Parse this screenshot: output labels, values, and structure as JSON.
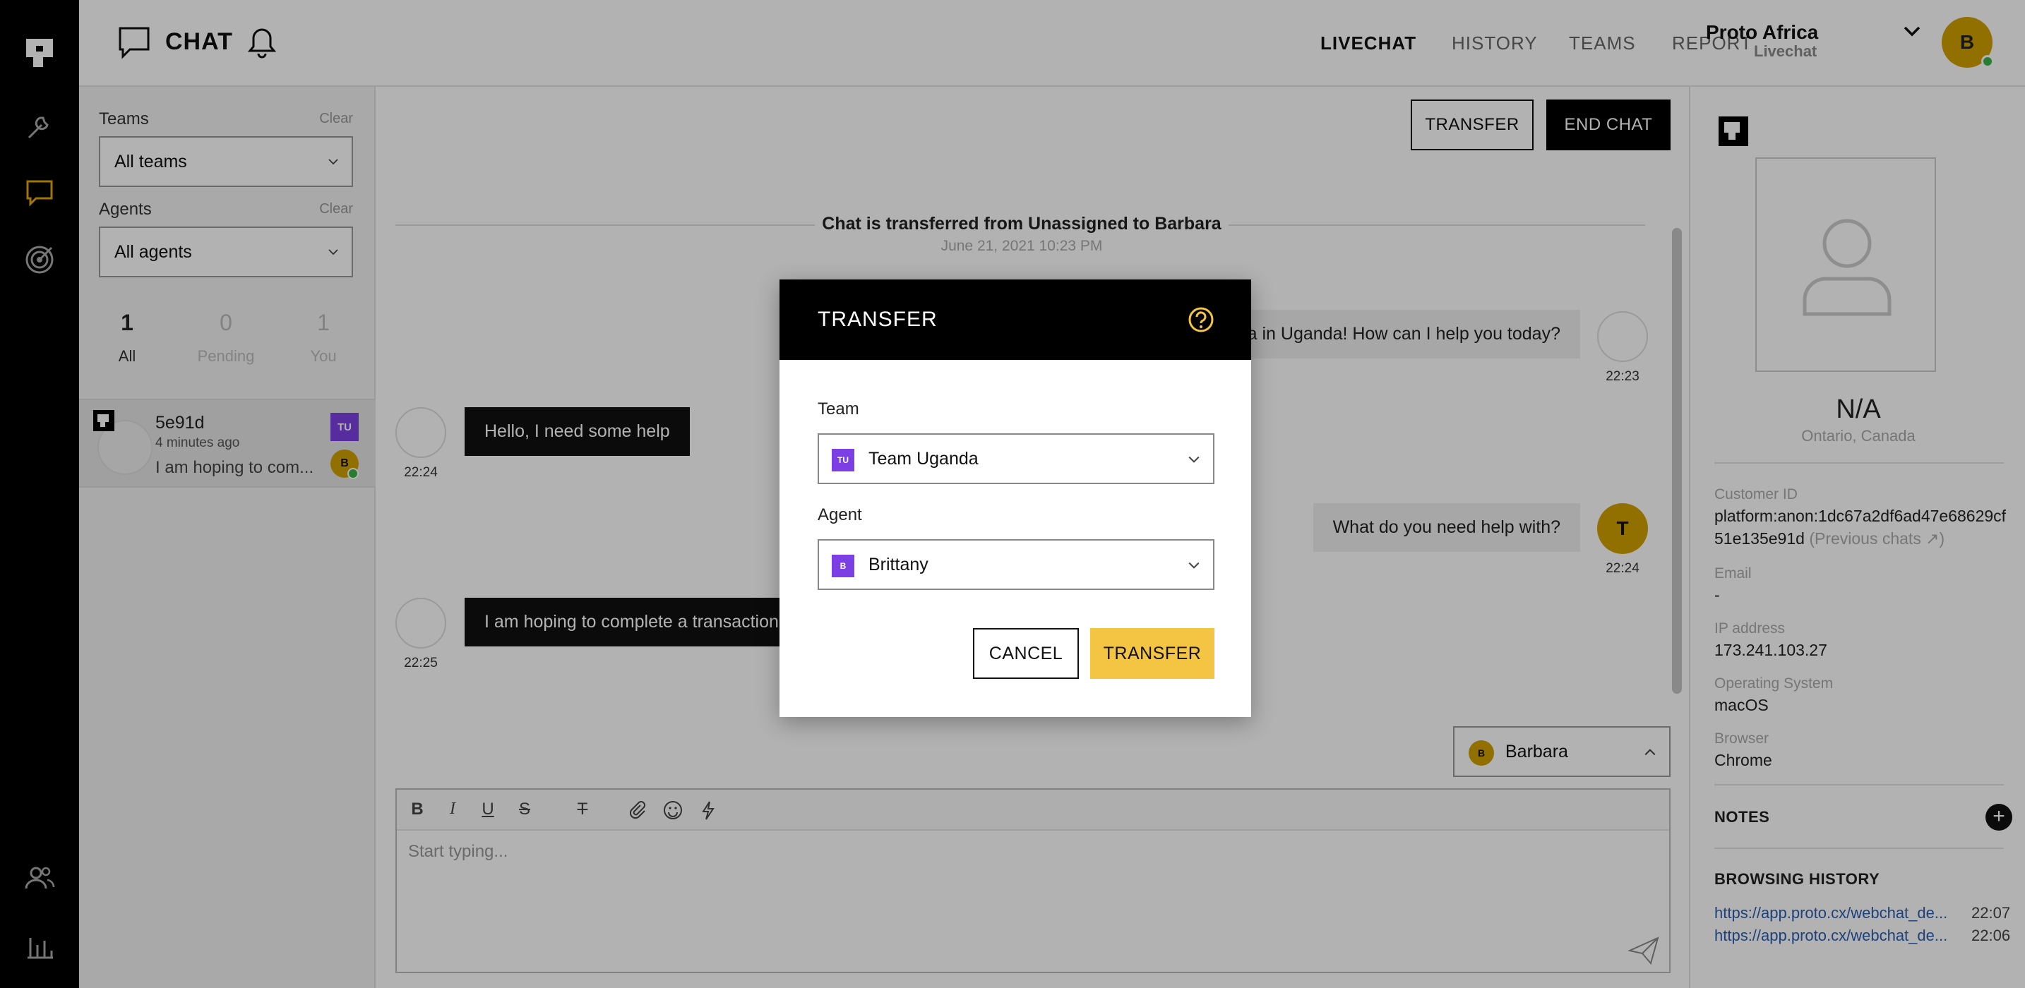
{
  "rail": {
    "items": [
      "proto-logo-icon",
      "wrench-icon",
      "chat-icon",
      "target-icon",
      "people-icon",
      "bar-chart-icon"
    ]
  },
  "header": {
    "title": "CHAT",
    "nav": [
      "LIVECHAT",
      "HISTORY",
      "TEAMS",
      "REPORT"
    ],
    "active_nav": "LIVECHAT",
    "org_name": "Proto Africa",
    "org_sub": "Livechat",
    "avatar_initial": "B"
  },
  "filters": {
    "teams_label": "Teams",
    "teams_clear": "Clear",
    "teams_value": "All teams",
    "agents_label": "Agents",
    "agents_clear": "Clear",
    "agents_value": "All agents",
    "counts": [
      {
        "num": "1",
        "label": "All"
      },
      {
        "num": "0",
        "label": "Pending"
      },
      {
        "num": "1",
        "label": "You"
      }
    ],
    "conversation": {
      "name": "5e91d",
      "time": "4 minutes ago",
      "preview": "I am hoping to com...",
      "team_badge": "TU",
      "agent_badge": "B"
    }
  },
  "main": {
    "transfer_button": "TRANSFER",
    "end_chat_button": "END CHAT",
    "system_message": "Chat is transferred from Unassigned to Barbara",
    "system_date": "June 21, 2021 10:23 PM",
    "messages": [
      {
        "side": "out",
        "text": "ca in Uganda! How can I help you today?",
        "time": "22:23"
      },
      {
        "side": "in",
        "text": "Hello, I need some help",
        "time": "22:24"
      },
      {
        "side": "out",
        "text": "What do you need help with?",
        "time": "22:24",
        "avatar": "T"
      },
      {
        "side": "in",
        "text": "I am hoping to complete a transaction,",
        "time": "22:25"
      }
    ],
    "assignee": "Barbara",
    "assignee_initial": "B",
    "composer_placeholder": "Start typing...",
    "toolbar": {
      "bold": "B",
      "italic": "I",
      "underline": "U",
      "strike": "S",
      "clear": "T"
    }
  },
  "profile": {
    "name": "N/A",
    "location": "Ontario, Canada",
    "customer_id_label": "Customer ID",
    "customer_id": "platform:anon:1dc67a2df6ad47e68629cf51e135e91d",
    "previous_chats": "(Previous chats",
    "email_label": "Email",
    "email": "-",
    "ip_label": "IP address",
    "ip": "173.241.103.27",
    "os_label": "Operating System",
    "os": "macOS",
    "browser_label": "Browser",
    "browser": "Chrome",
    "notes_label": "NOTES",
    "history_label": "BROWSING HISTORY",
    "history": [
      {
        "url": "https://app.proto.cx/webchat_de...",
        "time": "22:07"
      },
      {
        "url": "https://app.proto.cx/webchat_de...",
        "time": "22:06"
      }
    ]
  },
  "modal": {
    "title": "TRANSFER",
    "team_label": "Team",
    "team_value": "Team Uganda",
    "team_badge": "TU",
    "agent_label": "Agent",
    "agent_value": "Brittany",
    "agent_badge": "B",
    "cancel": "CANCEL",
    "transfer": "TRANSFER"
  },
  "colors": {
    "accent_yellow": "#f4c542",
    "avatar_gold": "#d1a100",
    "team_purple": "#7b3fe4",
    "online_green": "#39b54a"
  }
}
